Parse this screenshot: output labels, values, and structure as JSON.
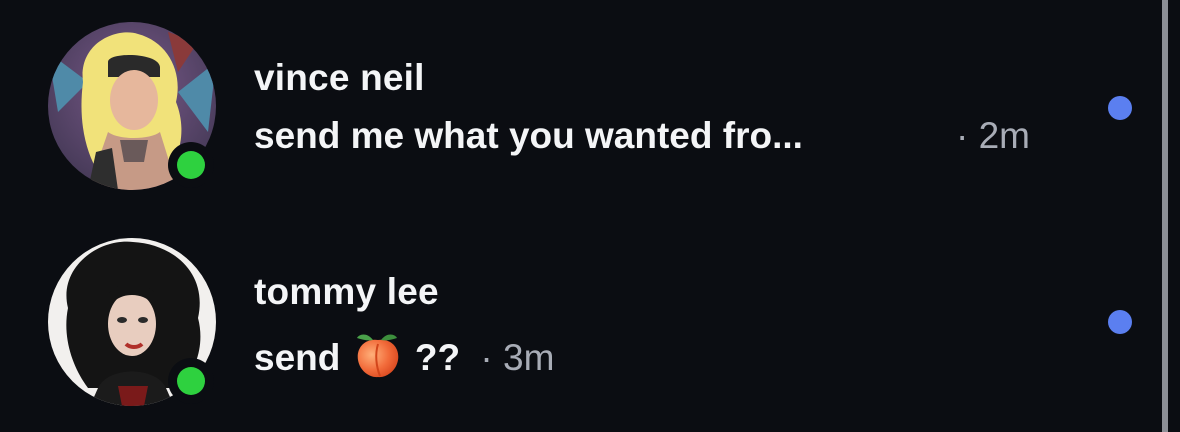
{
  "threads": [
    {
      "name": "vince neil",
      "preview": "send me what you wanted fro...",
      "separator": "·",
      "time": "2m",
      "online": true,
      "unread": true
    },
    {
      "name": "tommy lee",
      "preview_before": "send",
      "preview_emoji": "peach",
      "preview_after": "??",
      "separator": "·",
      "time": "3m",
      "online": true,
      "unread": true
    }
  ],
  "colors": {
    "background": "#0b0d12",
    "text": "#f4f5f7",
    "muted_text": "#a8acb6",
    "online": "#2ed13f",
    "unread_dot": "#5b7ff0"
  }
}
